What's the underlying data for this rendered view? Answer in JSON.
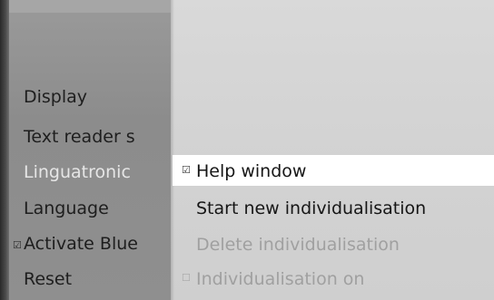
{
  "main_menu": {
    "items": [
      {
        "label": "Display"
      },
      {
        "label": "Text reader s"
      },
      {
        "label": "Linguatronic",
        "state": "active"
      },
      {
        "label": "Language"
      },
      {
        "label": "Activate Blue",
        "checked": true
      },
      {
        "label": "Reset"
      }
    ]
  },
  "submenu": {
    "items": [
      {
        "label": "Help window",
        "checked": true,
        "selected": true
      },
      {
        "label": "Start new individualisation"
      },
      {
        "label": "Delete individualisation",
        "disabled": true
      },
      {
        "label": "Individualisation on",
        "checked": false,
        "disabled": true
      }
    ]
  },
  "icons": {
    "checked": "☑",
    "unchecked": "☐"
  },
  "colors": {
    "left_panel": "#8f8f8f",
    "right_panel": "#d5d5d5",
    "highlight": "#ffffff",
    "active_text": "#e6e6e6",
    "disabled_text": "#a0a0a0"
  }
}
